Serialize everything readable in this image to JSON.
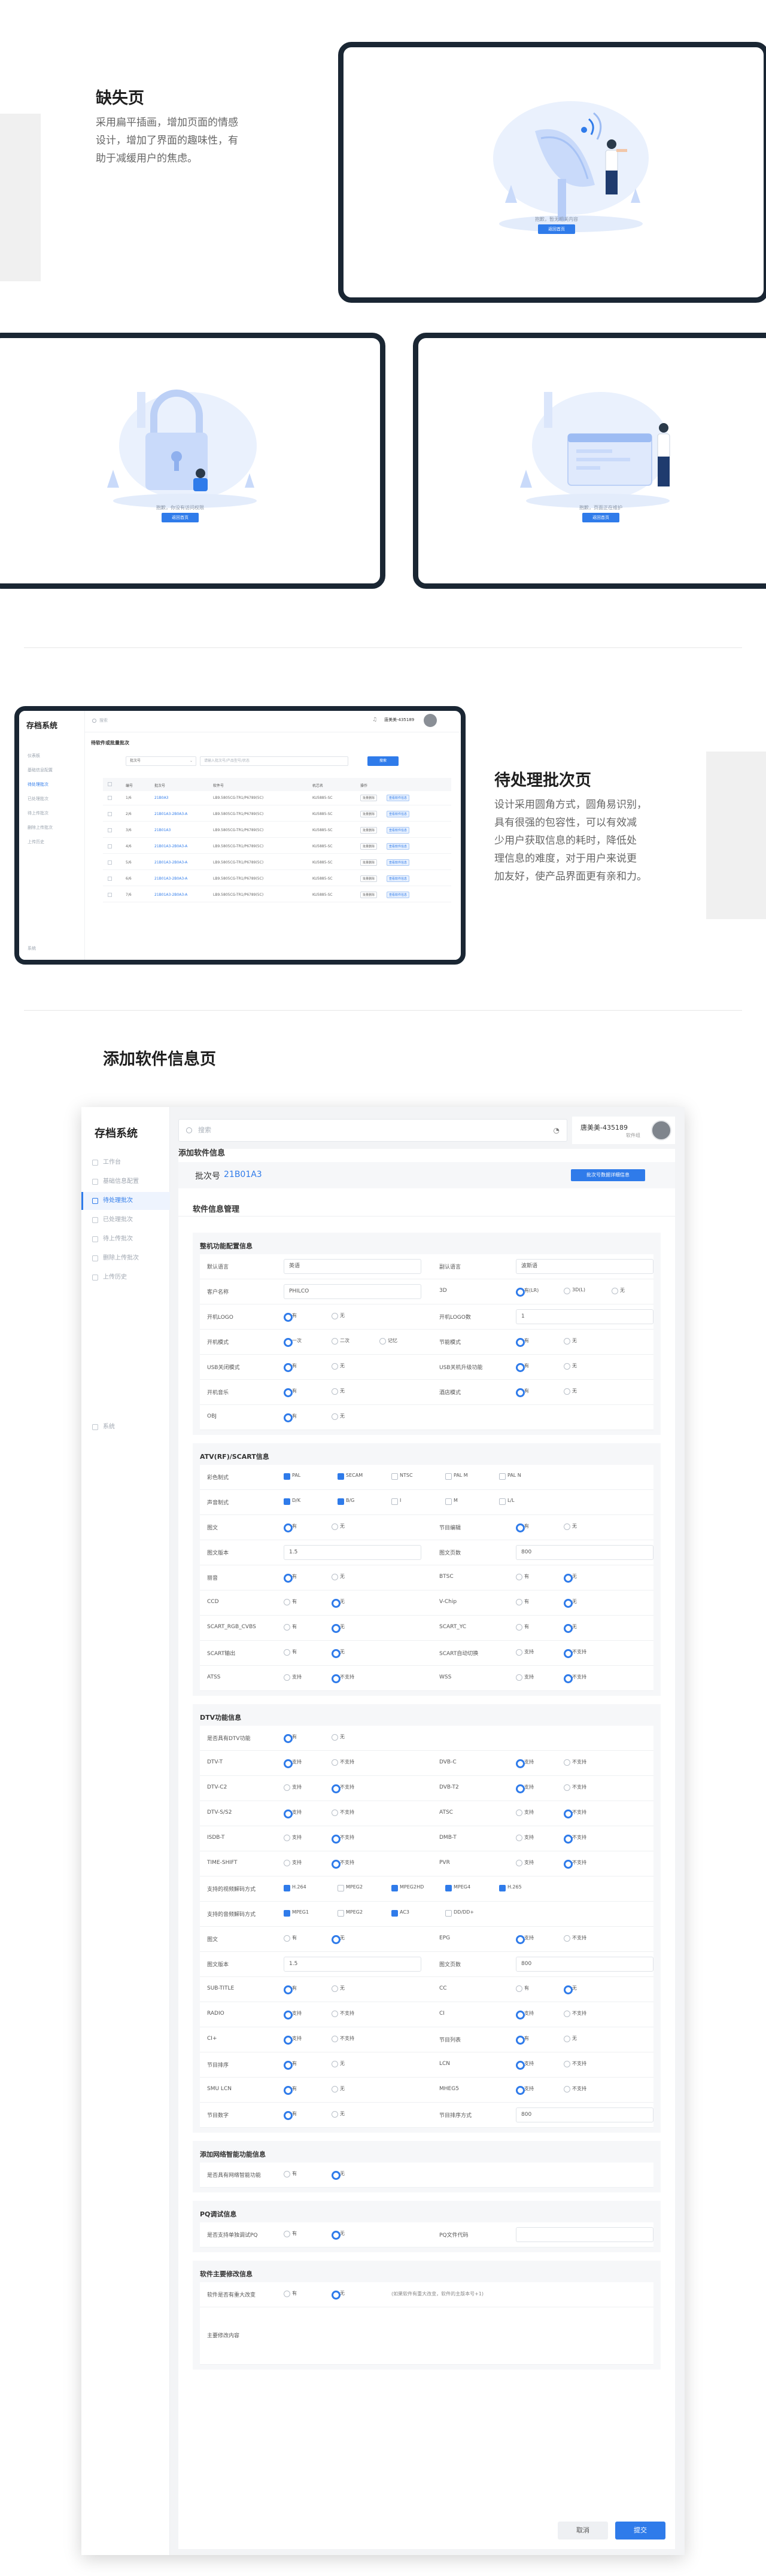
{
  "sections": {
    "missing": {
      "title": "缺失页",
      "desc_lines": [
        "采用扁平插画，增加页面的情感",
        "设计，增加了界面的趣味性，有",
        "助于减缓用户的焦虑。"
      ],
      "ill1_text": "抱歉，暂无相关内容",
      "ill2_text": "抱歉，你没有访问权限",
      "ill3_text": "抱歉，页面正在维护",
      "btn": "返回首页"
    },
    "batch": {
      "title": "待处理批次页",
      "desc_lines": [
        "设计采用圆角方式，圆角易识别，",
        "具有很强的包容性，可以有效减",
        "少用户获取信息的耗时，降低处",
        "理信息的难度，对于用户来说更",
        "加友好，使产品界面更有亲和力。"
      ]
    },
    "add": {
      "title": "添加软件信息页"
    }
  },
  "mini": {
    "logo": "存档系统",
    "search": "搜索",
    "user": "唐美美-435189",
    "page_title": "待软件或批量批次",
    "filter_select": "批次号",
    "filter_input": "请输入批次号/产品型号/状态",
    "search_btn": "搜索",
    "nav": [
      "仪表板",
      "基础信息配置",
      "待处理批次",
      "已处理批次",
      "待上传批次",
      "删除上传批次",
      "上传历史"
    ],
    "nav_bottom": "系统",
    "headers": [
      "编号",
      "批次号",
      "软件号",
      "机芯名",
      "操作"
    ],
    "rows": [
      [
        "1/6",
        "21B0A3",
        "LB9.5805CG-TR1/P6789(5C)",
        "KU5885-SC",
        "批量删除",
        "查看软件信息"
      ],
      [
        "2/6",
        "21B01A3-2B0A3-A",
        "LB9.5805CG-TR1/P6789(5C)",
        "KU5885-SC",
        "批量删除",
        "查看软件信息"
      ],
      [
        "3/6",
        "21B01A3",
        "LB9.5805CG-TR1/P6789(5C)",
        "KU5885-SC",
        "批量删除",
        "查看软件信息"
      ],
      [
        "4/6",
        "21B01A3-2B0A3-A",
        "LB9.5805CG-TR1/P6789(5C)",
        "KU5885-SC",
        "批量删除",
        "查看软件信息"
      ],
      [
        "5/6",
        "21B01A3-2B0A3-A",
        "LB9.5805CG-TR1/P6789(5C)",
        "KU5885-SC",
        "批量删除",
        "查看软件信息"
      ],
      [
        "6/6",
        "21B01A3-2B0A3-A",
        "LB9.5805CG-TR1/P6789(5C)",
        "KU5885-SC",
        "批量删除",
        "查看软件信息"
      ],
      [
        "7/6",
        "21B01A3-2B0A3-A",
        "LB9.5805CG-TR1/P6789(5C)",
        "KU5885-SC",
        "批量删除",
        "查看软件信息"
      ]
    ]
  },
  "app": {
    "logo": "存档系统",
    "nav": [
      "工作台",
      "基础信息配置",
      "待处理批次",
      "已处理批次",
      "待上传批次",
      "删除上传批次",
      "上传历史"
    ],
    "nav_bottom": "系统",
    "search": "搜索",
    "user_name": "唐美美-435189",
    "user_role": "软件组",
    "page_title": "添加软件信息",
    "batch_label": "批次号",
    "batch_value": "21B01A3",
    "batch_btn": "批次号数据详细信息",
    "mgmt_title": "软件信息管理",
    "g1_title": "整机功能配置信息",
    "g2_title": "ATV(RF)/SCART信息",
    "g3_title": "DTV功能信息",
    "g4_title": "添加网络智能功能信息",
    "g5_title": "PQ调试信息",
    "g6_title": "软件主要修改信息",
    "cancel": "取消",
    "submit": "提交",
    "f": {
      "lang_default": "默认语言",
      "lang_default_v": "英语",
      "lang_sub": "副认语言",
      "lang_sub_v": "波斯语",
      "customer": "客户名称",
      "customer_v": "PHILCO",
      "d3": "3D",
      "d3_a": "有(LR)",
      "d3_b": "3D(L)",
      "d3_c": "无",
      "logo_on": "开机LOGO",
      "yes": "有",
      "no": "无",
      "logo_count": "开机LOGO数",
      "logo_count_v": "1",
      "boot_mode": "开机模式",
      "boot_a": "一次",
      "boot_b": "二次",
      "boot_c": "记忆",
      "energy": "节能模式",
      "usb_mode": "USB关闭模式",
      "usb_upgrade": "USB关机升级功能",
      "boot_music": "开机音乐",
      "hotel": "酒店模式",
      "obj": "OBJ",
      "support": "支持",
      "not_support": "不支持",
      "color_sys": "彩色制式",
      "pal": "PAL",
      "secam": "SECAM",
      "ntsc": "NTSC",
      "palm": "PAL M",
      "paln": "PAL N",
      "sound_sys": "声音制式",
      "dk": "D/K",
      "bg": "B/G",
      "i": "I",
      "m": "M",
      "ll": "L/L",
      "teletext": "图文",
      "ch_edit": "节目编辑",
      "tt_ver": "图文版本",
      "tt_ver_v": "1.5",
      "tt_pages": "图文页数",
      "tt_pages_v": "800",
      "nicam": "丽音",
      "btsc": "BTSC",
      "cc": "CCD",
      "vchip": "V-Chip",
      "scart_rgb": "SCART_RGB_CVBS",
      "scart_yc": "SCART_YC",
      "scart_out": "SCART输出",
      "scart_auto": "SCART自动切换",
      "atss": "ATSS",
      "wss": "WSS",
      "smart_tv": "是否具有DTV功能",
      "dtvt": "DTV-T",
      "dvbc": "DVB-C",
      "dtvt2": "DTV-C2",
      "dvbt2": "DVB-T2",
      "dtvs": "DTV-S/S2",
      "atsc": "ATSC",
      "isdbt": "ISDB-T",
      "dmbt": "DMB-T",
      "timeshift": "TIME-SHIFT",
      "pvr": "PVR",
      "video_fmt": "支持的视频解码方式",
      "h264": "H.264",
      "mpeg2": "MPEG2",
      "mpeg2hd": "MPEG2HD",
      "mpeg4": "MPEG4",
      "h265": "H.265",
      "audio_fmt": "支持的音频解码方式",
      "mpeg1": "MPEG1",
      "ac3": "AC3",
      "ddplus": "DD/DD+",
      "teletext2": "图文",
      "epg": "EPG",
      "tt_ver2": "图文版本",
      "tt_pages2": "图文页数",
      "subtitle": "SUB-TITLE",
      "cc2": "CC",
      "radio": "RADIO",
      "ci": "CI",
      "ciplus": "CI+",
      "ch_list": "节目列表",
      "ch_sort": "节目排序",
      "lcn": "LCN",
      "smu_lcn": "SMU LCN",
      "mheg5": "MHEG5",
      "ch_count": "节目数字",
      "ch_order": "节目排序方式",
      "ch_order_v": "800",
      "net_fn": "是否具有网络智能功能",
      "pq_fn": "是否支持单独调试PQ",
      "pq_file": "PQ文件代码",
      "modify_fn": "软件是否有重大改变",
      "modify_hint": "(如果软件有重大改变，软件的主版本号+1)",
      "modify_main": "主要修改内容"
    }
  }
}
